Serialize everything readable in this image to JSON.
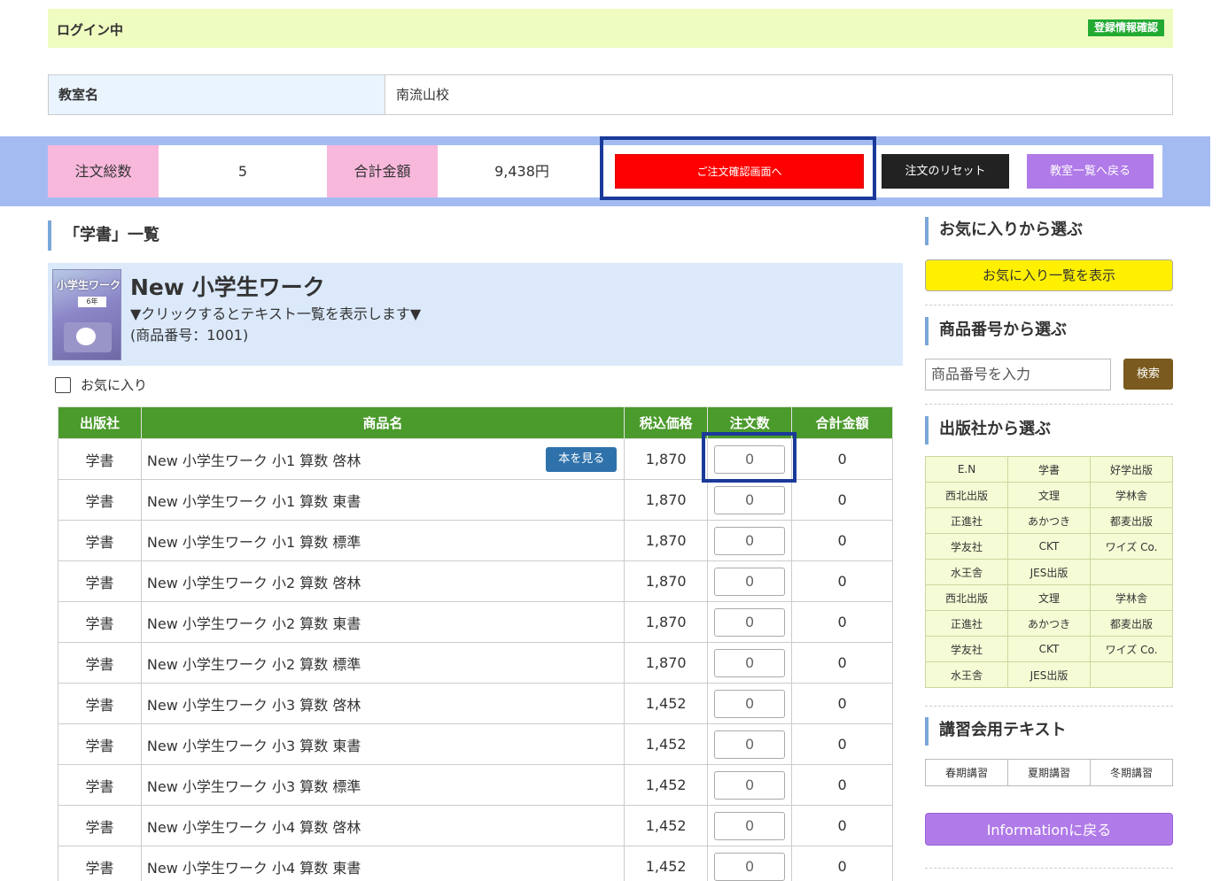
{
  "login": {
    "status": "ログイン中",
    "register_button": "登録情報確認"
  },
  "school": {
    "label": "教室名",
    "value": "南流山校"
  },
  "order": {
    "total_count_label": "注文総数",
    "total_count": "5",
    "total_amount_label": "合計金額",
    "total_amount": "9,438円",
    "confirm_button": "ご注文確認画面へ",
    "reset_button": "注文のリセット",
    "back_button": "教室一覧へ戻る"
  },
  "section": {
    "title": "「学書」一覧"
  },
  "product": {
    "name": "New 小学生ワーク",
    "instruction": "▼クリックするとテキスト一覧を表示します▼",
    "number": "(商品番号：1001)",
    "cover_title": "小学生ワーク",
    "cover_grade": "6年"
  },
  "favorite_label": "お気に入り",
  "table": {
    "headers": [
      "出版社",
      "商品名",
      "税込価格",
      "注文数",
      "合計金額"
    ],
    "view_button": "本を見る",
    "rows": [
      {
        "publisher": "学書",
        "name": "New 小学生ワーク 小1 算数 啓林",
        "price": "1,870",
        "qty": "0",
        "total": "0"
      },
      {
        "publisher": "学書",
        "name": "New 小学生ワーク 小1 算数 東書",
        "price": "1,870",
        "qty": "0",
        "total": "0"
      },
      {
        "publisher": "学書",
        "name": "New 小学生ワーク 小1 算数 標準",
        "price": "1,870",
        "qty": "0",
        "total": "0"
      },
      {
        "publisher": "学書",
        "name": "New 小学生ワーク 小2 算数 啓林",
        "price": "1,870",
        "qty": "0",
        "total": "0"
      },
      {
        "publisher": "学書",
        "name": "New 小学生ワーク 小2 算数 東書",
        "price": "1,870",
        "qty": "0",
        "total": "0"
      },
      {
        "publisher": "学書",
        "name": "New 小学生ワーク 小2 算数 標準",
        "price": "1,870",
        "qty": "0",
        "total": "0"
      },
      {
        "publisher": "学書",
        "name": "New 小学生ワーク 小3 算数 啓林",
        "price": "1,452",
        "qty": "0",
        "total": "0"
      },
      {
        "publisher": "学書",
        "name": "New 小学生ワーク 小3 算数 東書",
        "price": "1,452",
        "qty": "0",
        "total": "0"
      },
      {
        "publisher": "学書",
        "name": "New 小学生ワーク 小3 算数 標準",
        "price": "1,452",
        "qty": "0",
        "total": "0"
      },
      {
        "publisher": "学書",
        "name": "New 小学生ワーク 小4 算数 啓林",
        "price": "1,452",
        "qty": "0",
        "total": "0"
      },
      {
        "publisher": "学書",
        "name": "New 小学生ワーク 小4 算数 東書",
        "price": "1,452",
        "qty": "0",
        "total": "0"
      }
    ]
  },
  "sidebar": {
    "favorites_title": "お気に入りから選ぶ",
    "favorites_button": "お気に入り一覧を表示",
    "product_number_title": "商品番号から選ぶ",
    "product_number_placeholder": "商品番号を入力",
    "search_button": "検索",
    "publisher_title": "出版社から選ぶ",
    "publishers": [
      [
        "E.N",
        "学書",
        "好学出版"
      ],
      [
        "西北出版",
        "文理",
        "学林舎"
      ],
      [
        "正進社",
        "あかつき",
        "都麦出版"
      ],
      [
        "学友社",
        "CKT",
        "ワイズ Co."
      ],
      [
        "水王舎",
        "JES出版",
        ""
      ],
      [
        "西北出版",
        "文理",
        "学林舎"
      ],
      [
        "正進社",
        "あかつき",
        "都麦出版"
      ],
      [
        "学友社",
        "CKT",
        "ワイズ Co."
      ],
      [
        "水王舎",
        "JES出版",
        ""
      ]
    ],
    "seminar_title": "講習会用テキスト",
    "seminars": [
      "春期講習",
      "夏期講習",
      "冬期講習"
    ],
    "info_button": "Informationに戻る"
  }
}
